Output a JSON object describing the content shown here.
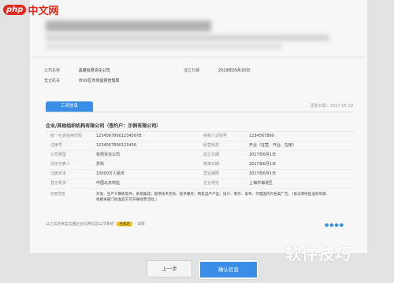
{
  "site": {
    "logo_php": "php",
    "logo_cn": "中文网"
  },
  "basic_info": [
    {
      "label": "公司名称",
      "value": "黑猫有限责任公司",
      "label2": "成立日期",
      "value2": "2019年05月20日"
    },
    {
      "label": "登记机关",
      "value": "市XX区市场监督管理局"
    }
  ],
  "tabs": {
    "active": "工商信息",
    "inactive": ""
  },
  "update_date": "更新日期：2017-05-19",
  "company_title": "企业/其他组织机构有限公司（签约户：示例有限公司）",
  "details": [
    {
      "l1": "统一社会信用代码",
      "v1": "12345678901234567B",
      "l2": "纳税人识别号",
      "v2": "1234567890"
    },
    {
      "l1": "注册号",
      "v1": "1234567890123456",
      "l2": "经营状态",
      "v2": "开业（在营、开业、在册）"
    },
    {
      "l1": "公司类型",
      "v1": "有限责任公司",
      "l2": "成立日期",
      "v2": "2017年6月1日"
    },
    {
      "l1": "法定代表人",
      "v1": "苏科",
      "l2": "核准日期",
      "v2": "2017年6月1日"
    },
    {
      "l1": "注册资本",
      "v1": "10000万人民币",
      "l2": "营业期限",
      "v2": "2017年6月1日"
    },
    {
      "l1": "登记机关",
      "v1": "中国北京商监",
      "l2": "企业地址",
      "v2": "上海市海淀区"
    }
  ],
  "scope": {
    "label": "经营范围",
    "text": "开发、生产计算机软件；系统集成；提供技术咨询、技术服务；销售自产产品；设计、制作、发布、代理国内外各类广告。（依法须经批准的项目，经相关部门批准后方可开展经营活动。）"
  },
  "footer": {
    "note": "以上信息来自全国企业信用信息公示系统",
    "badge": "已核定",
    "tail": "· 详情"
  },
  "buttons": {
    "prev": "上一步",
    "confirm": "确认信息"
  },
  "watermark": "软件技巧",
  "colors": {
    "accent": "#3a8ee6",
    "brand_red": "#e1261c",
    "badge": "#f0c419"
  }
}
